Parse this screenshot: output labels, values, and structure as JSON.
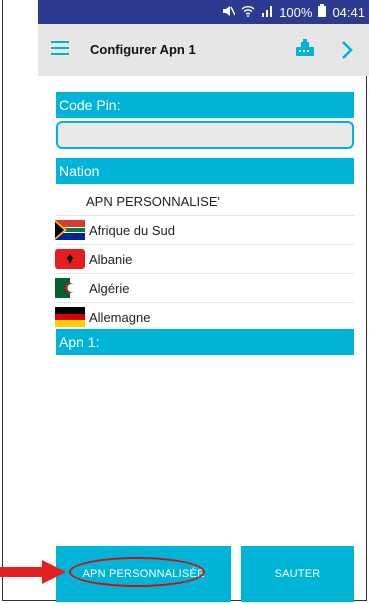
{
  "status_bar": {
    "battery": "100%",
    "time": "04:41"
  },
  "app_bar": {
    "title": "Configurer Apn 1"
  },
  "form": {
    "pin_label": "Code Pin:",
    "pin_value": "",
    "nation_label": "Nation",
    "apn_label": "Apn 1:"
  },
  "nations": [
    {
      "label": "APN PERSONNALISE'",
      "flag": "none"
    },
    {
      "label": "Afrique du Sud",
      "flag": "south-africa-flag"
    },
    {
      "label": "Albanie",
      "flag": "albania-flag"
    },
    {
      "label": "Algérie",
      "flag": "algeria-flag"
    },
    {
      "label": "Allemagne",
      "flag": "germany-flag"
    }
  ],
  "buttons": {
    "custom_apn": "APN PERSONNALISÉE",
    "skip": "SAUTER"
  },
  "colors": {
    "status_bar": "#2c3a8f",
    "accent": "#00b4d8",
    "annotation": "#d01010"
  }
}
